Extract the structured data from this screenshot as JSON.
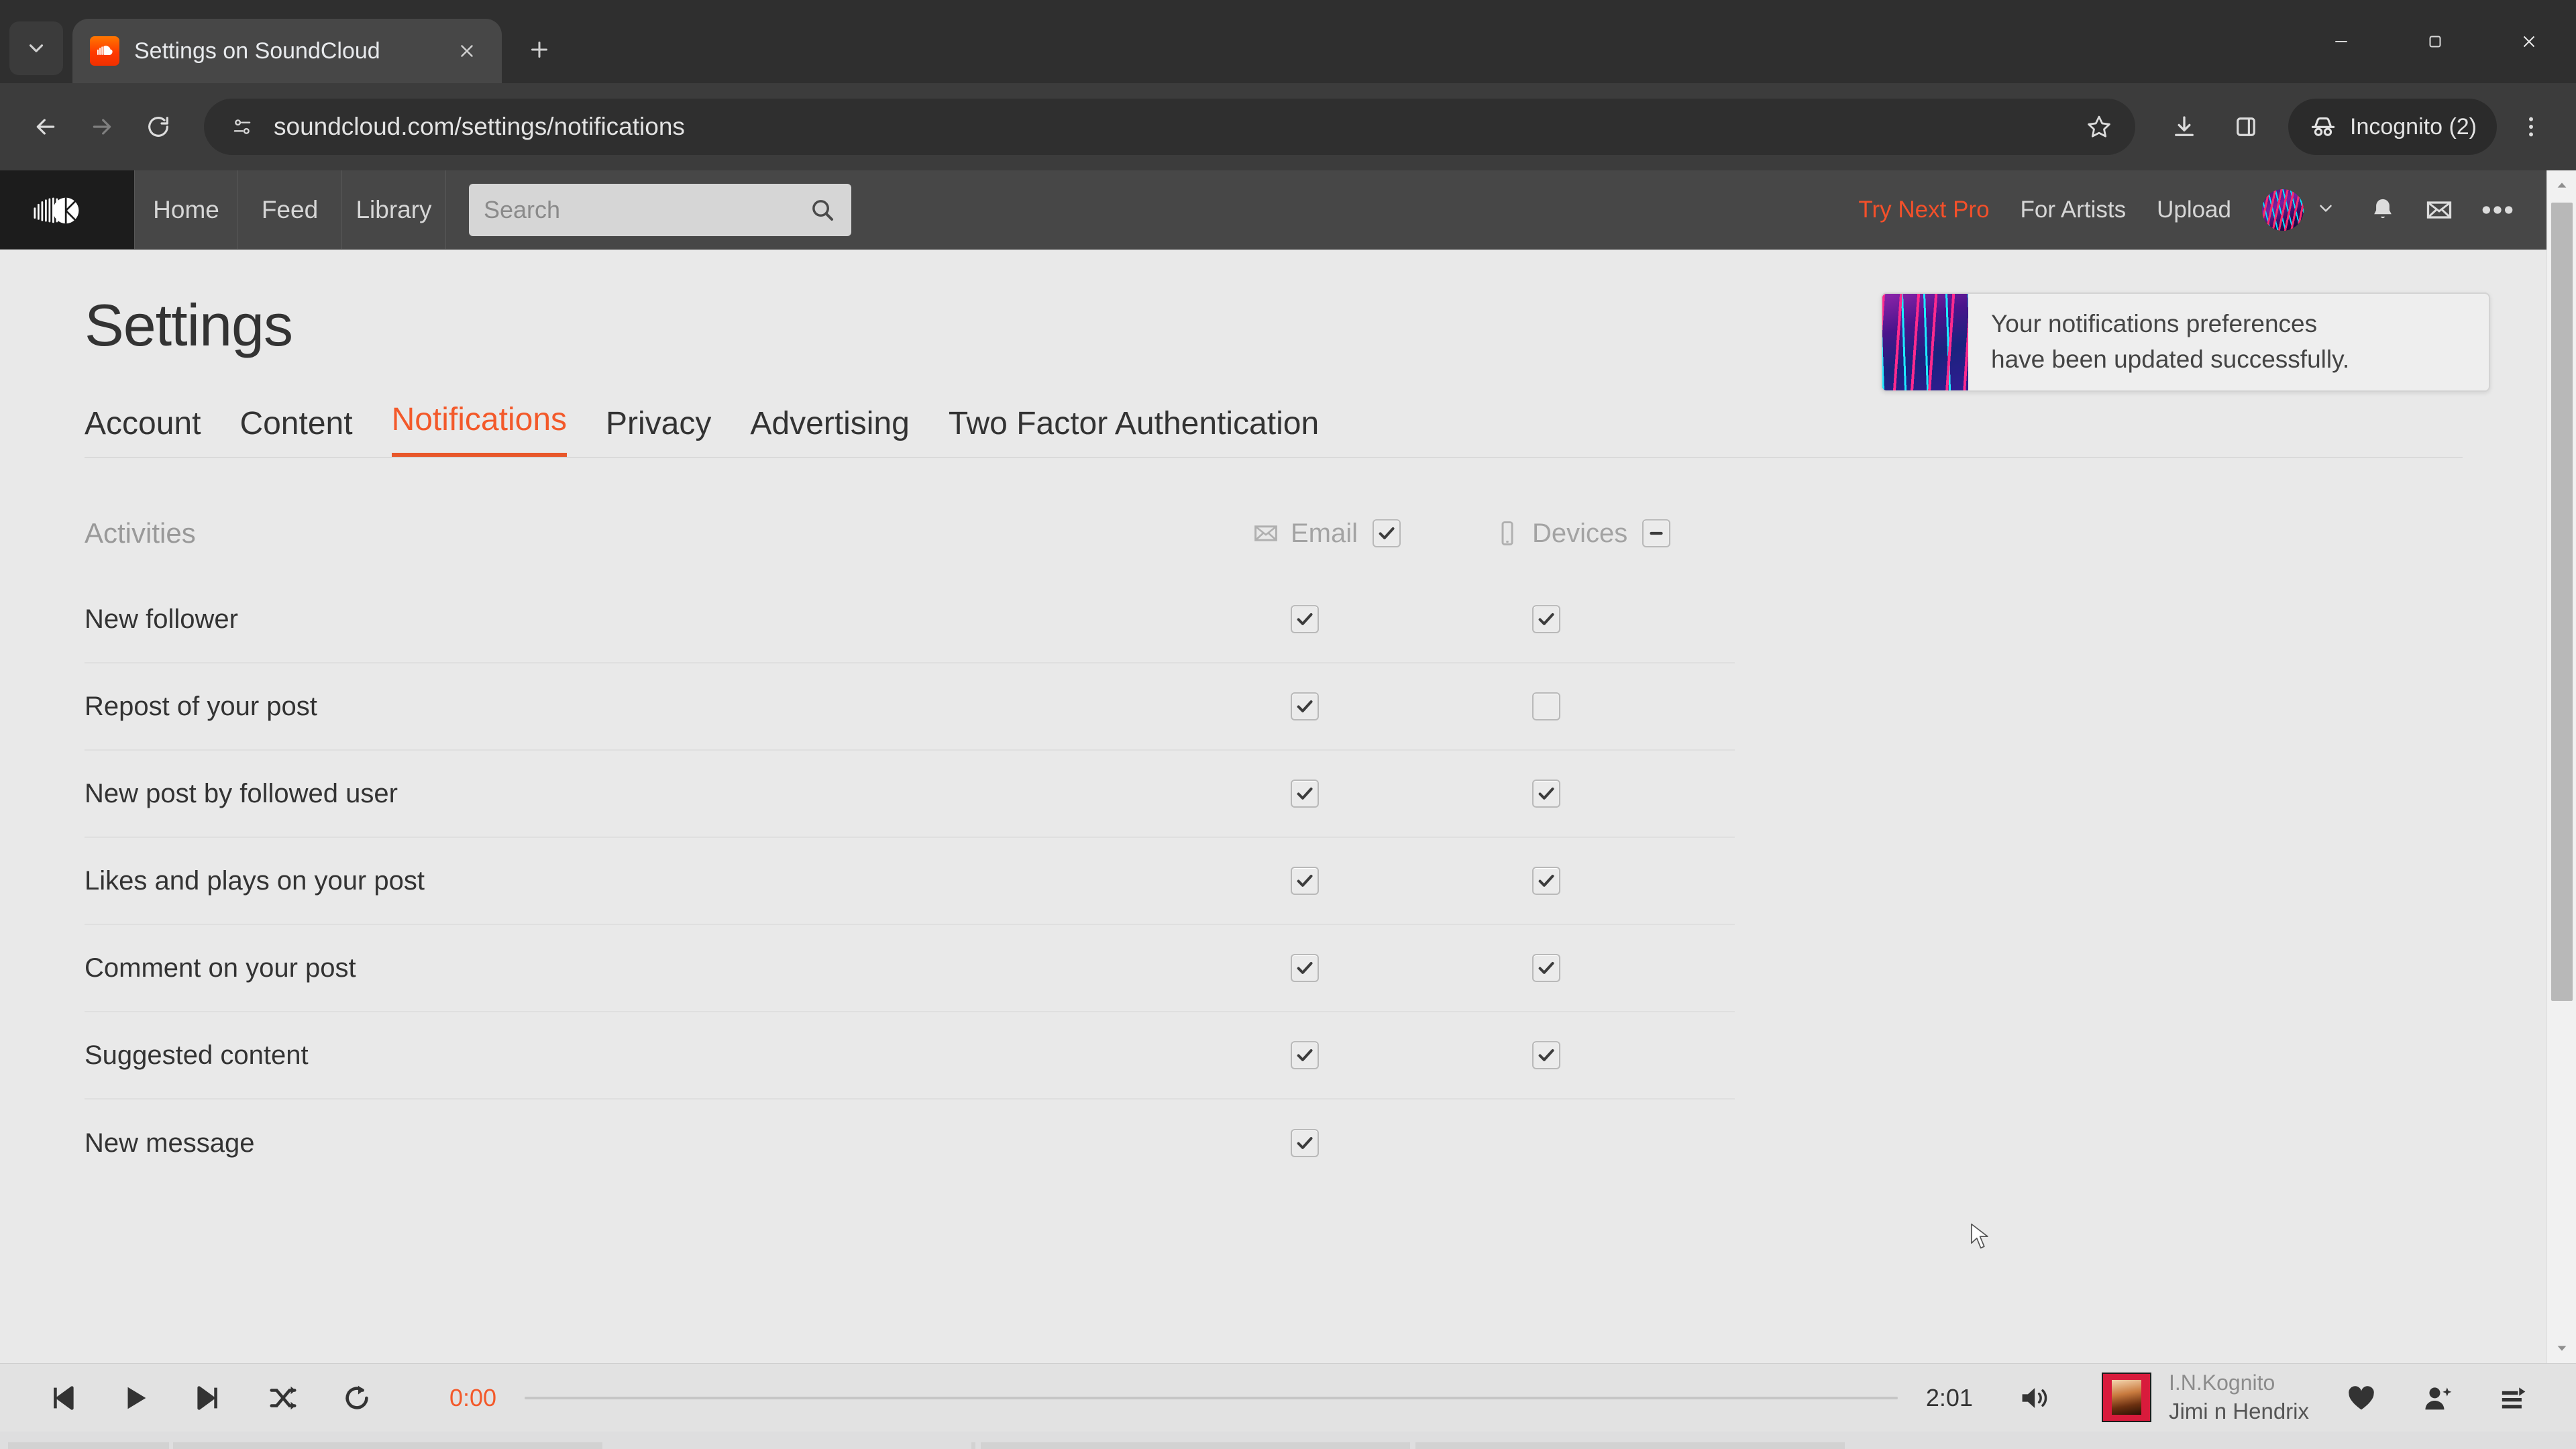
{
  "browser": {
    "tab": {
      "title": "Settings on SoundCloud",
      "favicon": "soundcloud-favicon"
    },
    "new_tab_label": "+",
    "omnibox": {
      "url": "soundcloud.com/settings/notifications",
      "placeholder": "Search Google or type a URL"
    },
    "profile": {
      "label": "Incognito (2)"
    },
    "icons": {
      "tab_search": "chevron-down-icon",
      "close": "close-icon",
      "back": "back-arrow-icon",
      "forward": "forward-arrow-icon",
      "reload": "reload-icon",
      "site_info": "tune-icon",
      "bookmark": "star-icon",
      "downloads": "download-icon",
      "side_panel": "side-panel-icon",
      "incognito": "incognito-icon",
      "menu": "three-dot-menu-icon",
      "minimize": "minimize-icon",
      "maximize": "maximize-icon",
      "window_close": "window-close-icon"
    }
  },
  "site_header": {
    "logo": "soundcloud-logo",
    "nav": [
      {
        "label": "Home"
      },
      {
        "label": "Feed"
      },
      {
        "label": "Library"
      }
    ],
    "search": {
      "placeholder": "Search",
      "value": "",
      "icon": "search-icon"
    },
    "right_links": [
      {
        "label": "Try Next Pro",
        "accent": true
      },
      {
        "label": "For Artists",
        "accent": false
      },
      {
        "label": "Upload",
        "accent": false
      }
    ],
    "avatar": "user-avatar",
    "caret": "chevron-down-icon",
    "action_icons": [
      {
        "name": "bell-icon"
      },
      {
        "name": "mail-icon"
      },
      {
        "name": "more-horizontal-icon"
      }
    ]
  },
  "main": {
    "page_title": "Settings",
    "tabs": [
      {
        "label": "Account",
        "active": false
      },
      {
        "label": "Content",
        "active": false
      },
      {
        "label": "Notifications",
        "active": true
      },
      {
        "label": "Privacy",
        "active": false
      },
      {
        "label": "Advertising",
        "active": false
      },
      {
        "label": "Two Factor Authentication",
        "active": false
      }
    ],
    "section": {
      "title": "Activities",
      "columns": [
        {
          "label": "Email",
          "icon": "envelope-icon",
          "master_state": "checked"
        },
        {
          "label": "Devices",
          "icon": "mobile-phone-icon",
          "master_state": "indeterminate"
        }
      ]
    },
    "rows": [
      {
        "label": "New follower",
        "email": "checked",
        "devices": "checked"
      },
      {
        "label": "Repost of your post",
        "email": "checked",
        "devices": "unchecked"
      },
      {
        "label": "New post by followed user",
        "email": "checked",
        "devices": "checked"
      },
      {
        "label": "Likes and plays on your post",
        "email": "checked",
        "devices": "checked"
      },
      {
        "label": "Comment on your post",
        "email": "checked",
        "devices": "checked"
      },
      {
        "label": "Suggested content",
        "email": "checked",
        "devices": "checked"
      },
      {
        "label": "New message",
        "email": "checked",
        "devices": "none"
      }
    ]
  },
  "toast": {
    "line1": "Your notifications preferences",
    "line2": "have been updated successfully.",
    "artwork": "album-artwork"
  },
  "player": {
    "controls": [
      {
        "name": "skip-previous-icon"
      },
      {
        "name": "play-icon"
      },
      {
        "name": "skip-next-icon"
      },
      {
        "name": "shuffle-icon"
      },
      {
        "name": "repeat-icon"
      }
    ],
    "elapsed": "0:00",
    "duration": "2:01",
    "volume_icon": "volume-icon",
    "track": {
      "artist": "I.N.Kognito",
      "title": "Jimi n Hendrix"
    },
    "right_icons": [
      {
        "name": "heart-icon"
      },
      {
        "name": "add-user-icon"
      },
      {
        "name": "add-to-queue-icon"
      }
    ]
  },
  "colors": {
    "accent_orange": "#f3592a",
    "chrome_dark": "#3c3c3c",
    "page_bg": "#e9e9e9",
    "header_bg": "#474747"
  }
}
